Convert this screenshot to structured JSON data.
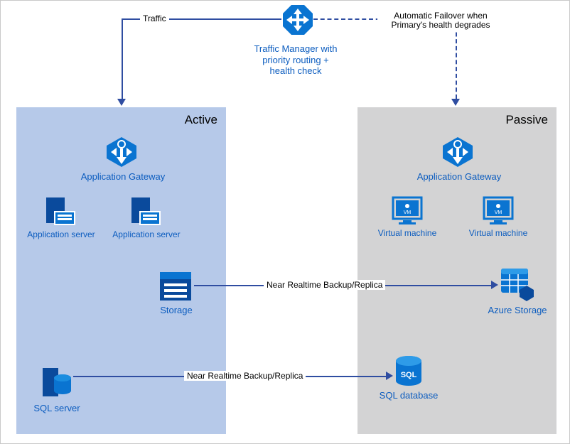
{
  "traffic_manager": {
    "label": "Traffic Manager with priority routing + health check"
  },
  "edges": {
    "traffic": "Traffic",
    "failover": "Automatic Failover when Primary's health degrades",
    "backup_storage": "Near Realtime Backup/Replica",
    "backup_sql": "Near Realtime Backup/Replica"
  },
  "active_region": {
    "title": "Active",
    "app_gateway": "Application Gateway",
    "app_server_1": "Application server",
    "app_server_2": "Application server",
    "storage": "Storage",
    "sql_server": "SQL server"
  },
  "passive_region": {
    "title": "Passive",
    "app_gateway": "Application Gateway",
    "vm_1": "Virtual machine",
    "vm_2": "Virtual machine",
    "azure_storage": "Azure Storage",
    "sql_database": "SQL database"
  },
  "chart_data": {
    "type": "diagram",
    "title": "Active/Passive failover architecture with Traffic Manager",
    "nodes": [
      {
        "id": "traffic-manager",
        "label": "Traffic Manager with priority routing + health check",
        "group": null
      },
      {
        "id": "active-app-gateway",
        "label": "Application Gateway",
        "group": "Active"
      },
      {
        "id": "active-app-server-1",
        "label": "Application server",
        "group": "Active"
      },
      {
        "id": "active-app-server-2",
        "label": "Application server",
        "group": "Active"
      },
      {
        "id": "active-storage",
        "label": "Storage",
        "group": "Active"
      },
      {
        "id": "active-sql-server",
        "label": "SQL server",
        "group": "Active"
      },
      {
        "id": "passive-app-gateway",
        "label": "Application Gateway",
        "group": "Passive"
      },
      {
        "id": "passive-vm-1",
        "label": "Virtual machine",
        "group": "Passive"
      },
      {
        "id": "passive-vm-2",
        "label": "Virtual machine",
        "group": "Passive"
      },
      {
        "id": "passive-azure-storage",
        "label": "Azure Storage",
        "group": "Passive"
      },
      {
        "id": "passive-sql-database",
        "label": "SQL database",
        "group": "Passive"
      }
    ],
    "groups": [
      {
        "id": "Active",
        "label": "Active"
      },
      {
        "id": "Passive",
        "label": "Passive"
      }
    ],
    "edges": [
      {
        "from": "traffic-manager",
        "to": "active-app-gateway",
        "label": "Traffic",
        "style": "solid"
      },
      {
        "from": "traffic-manager",
        "to": "passive-app-gateway",
        "label": "Automatic Failover when Primary's health degrades",
        "style": "dashed"
      },
      {
        "from": "active-storage",
        "to": "passive-azure-storage",
        "label": "Near Realtime Backup/Replica",
        "style": "solid"
      },
      {
        "from": "active-sql-server",
        "to": "passive-sql-database",
        "label": "Near Realtime Backup/Replica",
        "style": "solid"
      }
    ]
  }
}
